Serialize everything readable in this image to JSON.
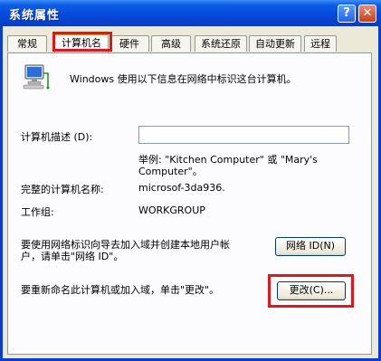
{
  "window": {
    "title": "系统属性",
    "help_glyph": "?",
    "close_glyph": "✕"
  },
  "tabs": [
    {
      "label": "常规"
    },
    {
      "label": "计算机名"
    },
    {
      "label": "硬件"
    },
    {
      "label": "高级"
    },
    {
      "label": "系统还原"
    },
    {
      "label": "自动更新"
    },
    {
      "label": "远程"
    }
  ],
  "active_tab_index": 1,
  "panel": {
    "intro_text": "Windows 使用以下信息在网络中标识这台计算机。",
    "description_label": "计算机描述 (D):",
    "description_value": "",
    "example_line1": "举例: \"Kitchen Computer\" 或 \"Mary's",
    "example_line2": "Computer\"。",
    "fullname_label": "完整的计算机名称:",
    "fullname_value": "microsof-3da936.",
    "workgroup_label": "工作组:",
    "workgroup_value": "WORKGROUP",
    "network_id_text_line1": "要使用网络标识向导去加入域并创建本地用户帐",
    "network_id_text_line2": "户，请单击\"网络 ID\"。",
    "network_id_button": "网络 ID(N)",
    "rename_text": "要重新命名此计算机或加入域，单击\"更改\"。",
    "change_button": "更改(C)..."
  },
  "colors": {
    "titlebar": "#0b5ce6",
    "highlight_red": "#e0161a",
    "dialog_bg": "#ece9d8"
  },
  "icons": {
    "computer": "computer-network-icon"
  }
}
